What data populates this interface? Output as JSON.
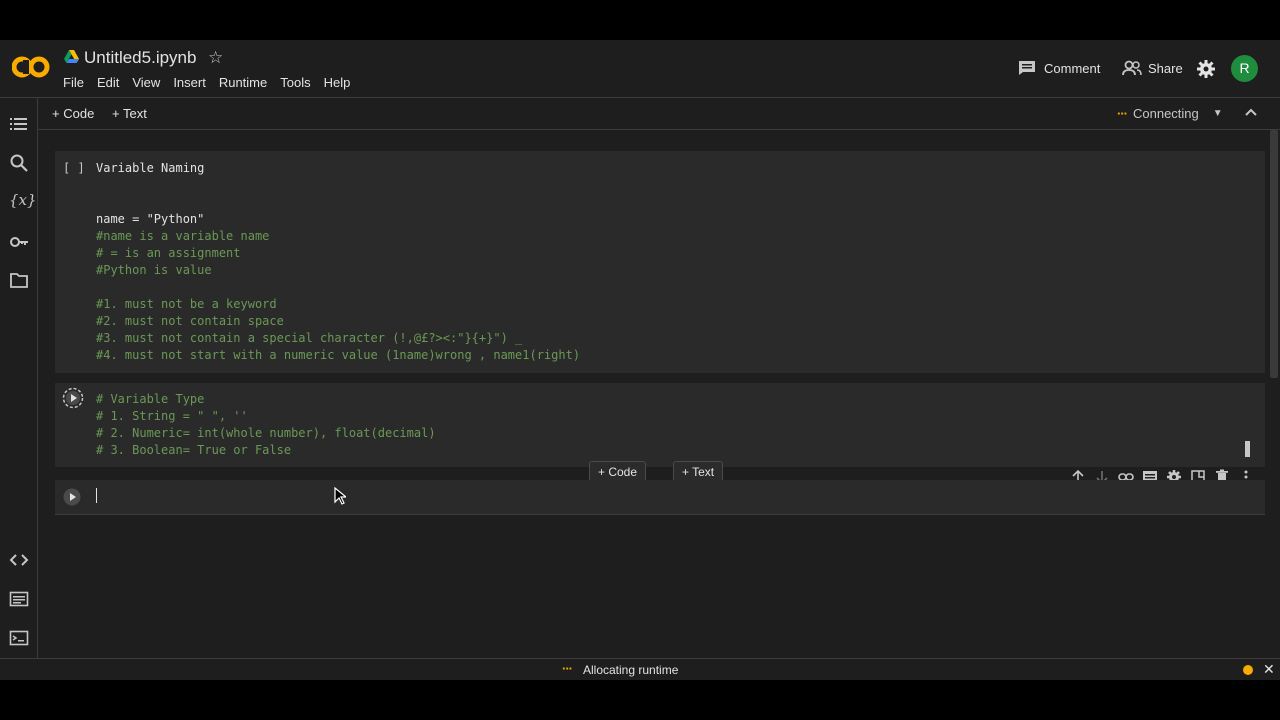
{
  "header": {
    "title": "Untitled5.ipynb",
    "menu": [
      "File",
      "Edit",
      "View",
      "Insert",
      "Runtime",
      "Tools",
      "Help"
    ],
    "comment_label": "Comment",
    "share_label": "Share",
    "avatar_letter": "R"
  },
  "toolbar": {
    "add_code_label": "Code",
    "add_text_label": "Text",
    "connection_status": "Connecting"
  },
  "cells": [
    {
      "execution_bracket": "[ ]",
      "lines": [
        "Variable Naming",
        "",
        "",
        "name = \"Python\"",
        "#name is a variable name",
        "# = is an assignment",
        "#Python is value",
        "",
        "#1. must not be a keyword",
        "#2. must not contain space",
        "#3. must not contain a special character (!,@£?><:\"}{+}\") _",
        "#4. must not start with a numeric value (1name)wrong , name1(right)"
      ]
    },
    {
      "lines": [
        "# Variable Type",
        "# 1. String = \" \", ''",
        "# 2. Numeric= int(whole number), float(decimal)",
        "# 3. Boolean= True or False"
      ]
    },
    {
      "lines": [
        ""
      ]
    }
  ],
  "between_cells": {
    "add_code_label": "Code",
    "add_text_label": "Text"
  },
  "statusbar": {
    "text": "Allocating runtime"
  },
  "colors": {
    "accent_orange": "#f9ab00",
    "avatar_green": "#1e8e3e",
    "comment_green": "#6a9955",
    "string_orange": "#ce9178"
  },
  "icons": {
    "sidebar": [
      "toc-icon",
      "search-icon",
      "variables-icon",
      "key-icon",
      "folder-icon",
      "code-snippets-icon",
      "command-palette-icon",
      "terminal-icon"
    ],
    "cell_toolbar": [
      "arrow-up-icon",
      "arrow-down-icon",
      "link-icon",
      "comment-icon",
      "gear-icon",
      "mirror-cell-icon",
      "delete-icon",
      "more-vert-icon"
    ]
  }
}
